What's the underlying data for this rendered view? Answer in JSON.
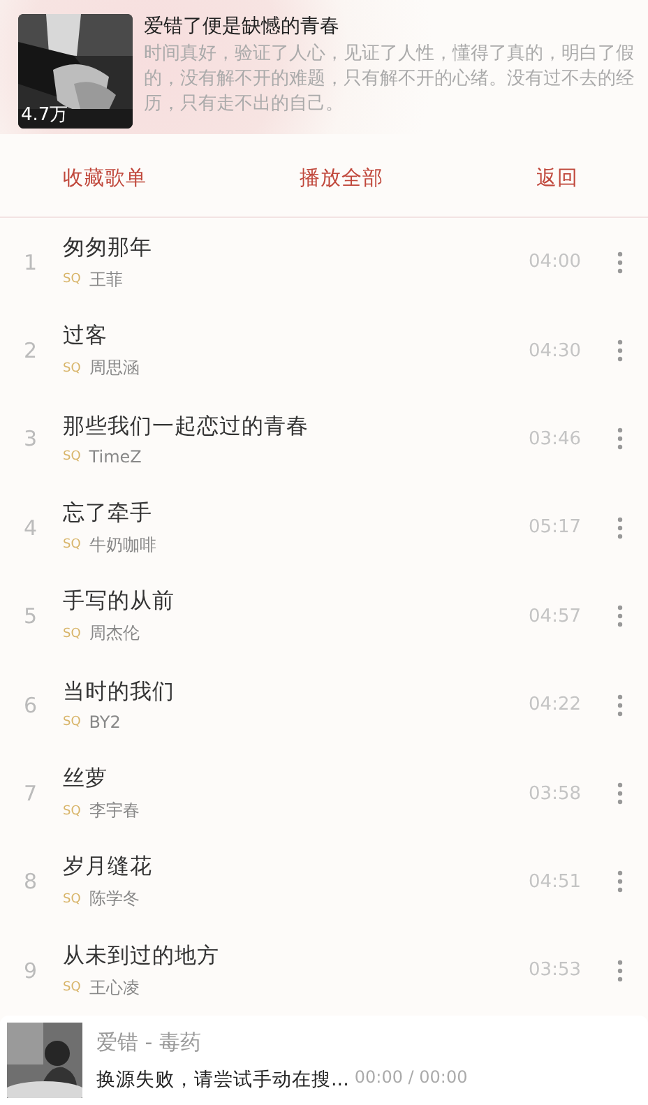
{
  "playlist": {
    "cover": {
      "kind": "picture",
      "play_count": "4.7万"
    },
    "title": "爱错了便是缺憾的青春",
    "description": "时间真好，验证了人心，见证了人性，懂得了真的，明白了假的，没有解不开的难题，只有解不开的心绪。没有过不去的经历，只有走不出的自己。"
  },
  "actions": [
    "收藏歌单",
    "播放全部",
    "返回"
  ],
  "songs": [
    {
      "index": "1",
      "title": "匆匆那年",
      "quality": "SQ",
      "artist": "王菲",
      "duration": "04:00"
    },
    {
      "index": "2",
      "title": "过客",
      "quality": "SQ",
      "artist": "周思涵",
      "duration": "04:30"
    },
    {
      "index": "3",
      "title": "那些我们一起恋过的青春",
      "quality": "SQ",
      "artist": "TimeZ",
      "duration": "03:46"
    },
    {
      "index": "4",
      "title": "忘了牵手",
      "quality": "SQ",
      "artist": "牛奶咖啡",
      "duration": "05:17"
    },
    {
      "index": "5",
      "title": "手写的从前",
      "quality": "SQ",
      "artist": "周杰伦",
      "duration": "04:57"
    },
    {
      "index": "6",
      "title": "当时的我们",
      "quality": "SQ",
      "artist": "BY2",
      "duration": "04:22"
    },
    {
      "index": "7",
      "title": "丝萝",
      "quality": "SQ",
      "artist": "李宇春",
      "duration": "03:58"
    },
    {
      "index": "8",
      "title": "岁月缝花",
      "quality": "SQ",
      "artist": "陈学冬",
      "duration": "04:51"
    },
    {
      "index": "9",
      "title": "从未到过的地方",
      "quality": "SQ",
      "artist": "王心凌",
      "duration": "03:53"
    }
  ],
  "player": {
    "track": "爱错 - 毒药",
    "status": "换源失败，请尝试手动在搜...",
    "time": "00:00 / 00:00"
  }
}
